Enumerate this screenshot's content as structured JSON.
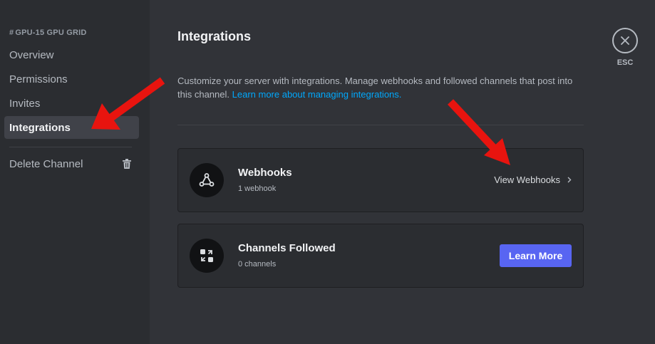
{
  "sidebar": {
    "header_hash": "#",
    "header_label": "GPU-15 GPU GRID",
    "items": [
      {
        "label": "Overview"
      },
      {
        "label": "Permissions"
      },
      {
        "label": "Invites"
      },
      {
        "label": "Integrations"
      }
    ],
    "delete_label": "Delete Channel",
    "delete_icon": "trash-icon"
  },
  "main": {
    "title": "Integrations",
    "description": "Customize your server with integrations. Manage webhooks and followed channels that post into this channel.",
    "learn_link": "Learn more about managing integrations.",
    "cards": [
      {
        "title": "Webhooks",
        "subtitle": "1 webhook",
        "icon": "webhook-icon",
        "action": "View Webhooks"
      },
      {
        "title": "Channels Followed",
        "subtitle": "0 channels",
        "icon": "channels-followed-icon",
        "action": "Learn More"
      }
    ]
  },
  "esc": {
    "label": "ESC"
  },
  "colors": {
    "background": "#313338",
    "sidebar": "#2b2d31",
    "active_item": "#404249",
    "link": "#00a8fc",
    "brand_button": "#5865f2",
    "annotation_arrow": "#e8140f"
  }
}
